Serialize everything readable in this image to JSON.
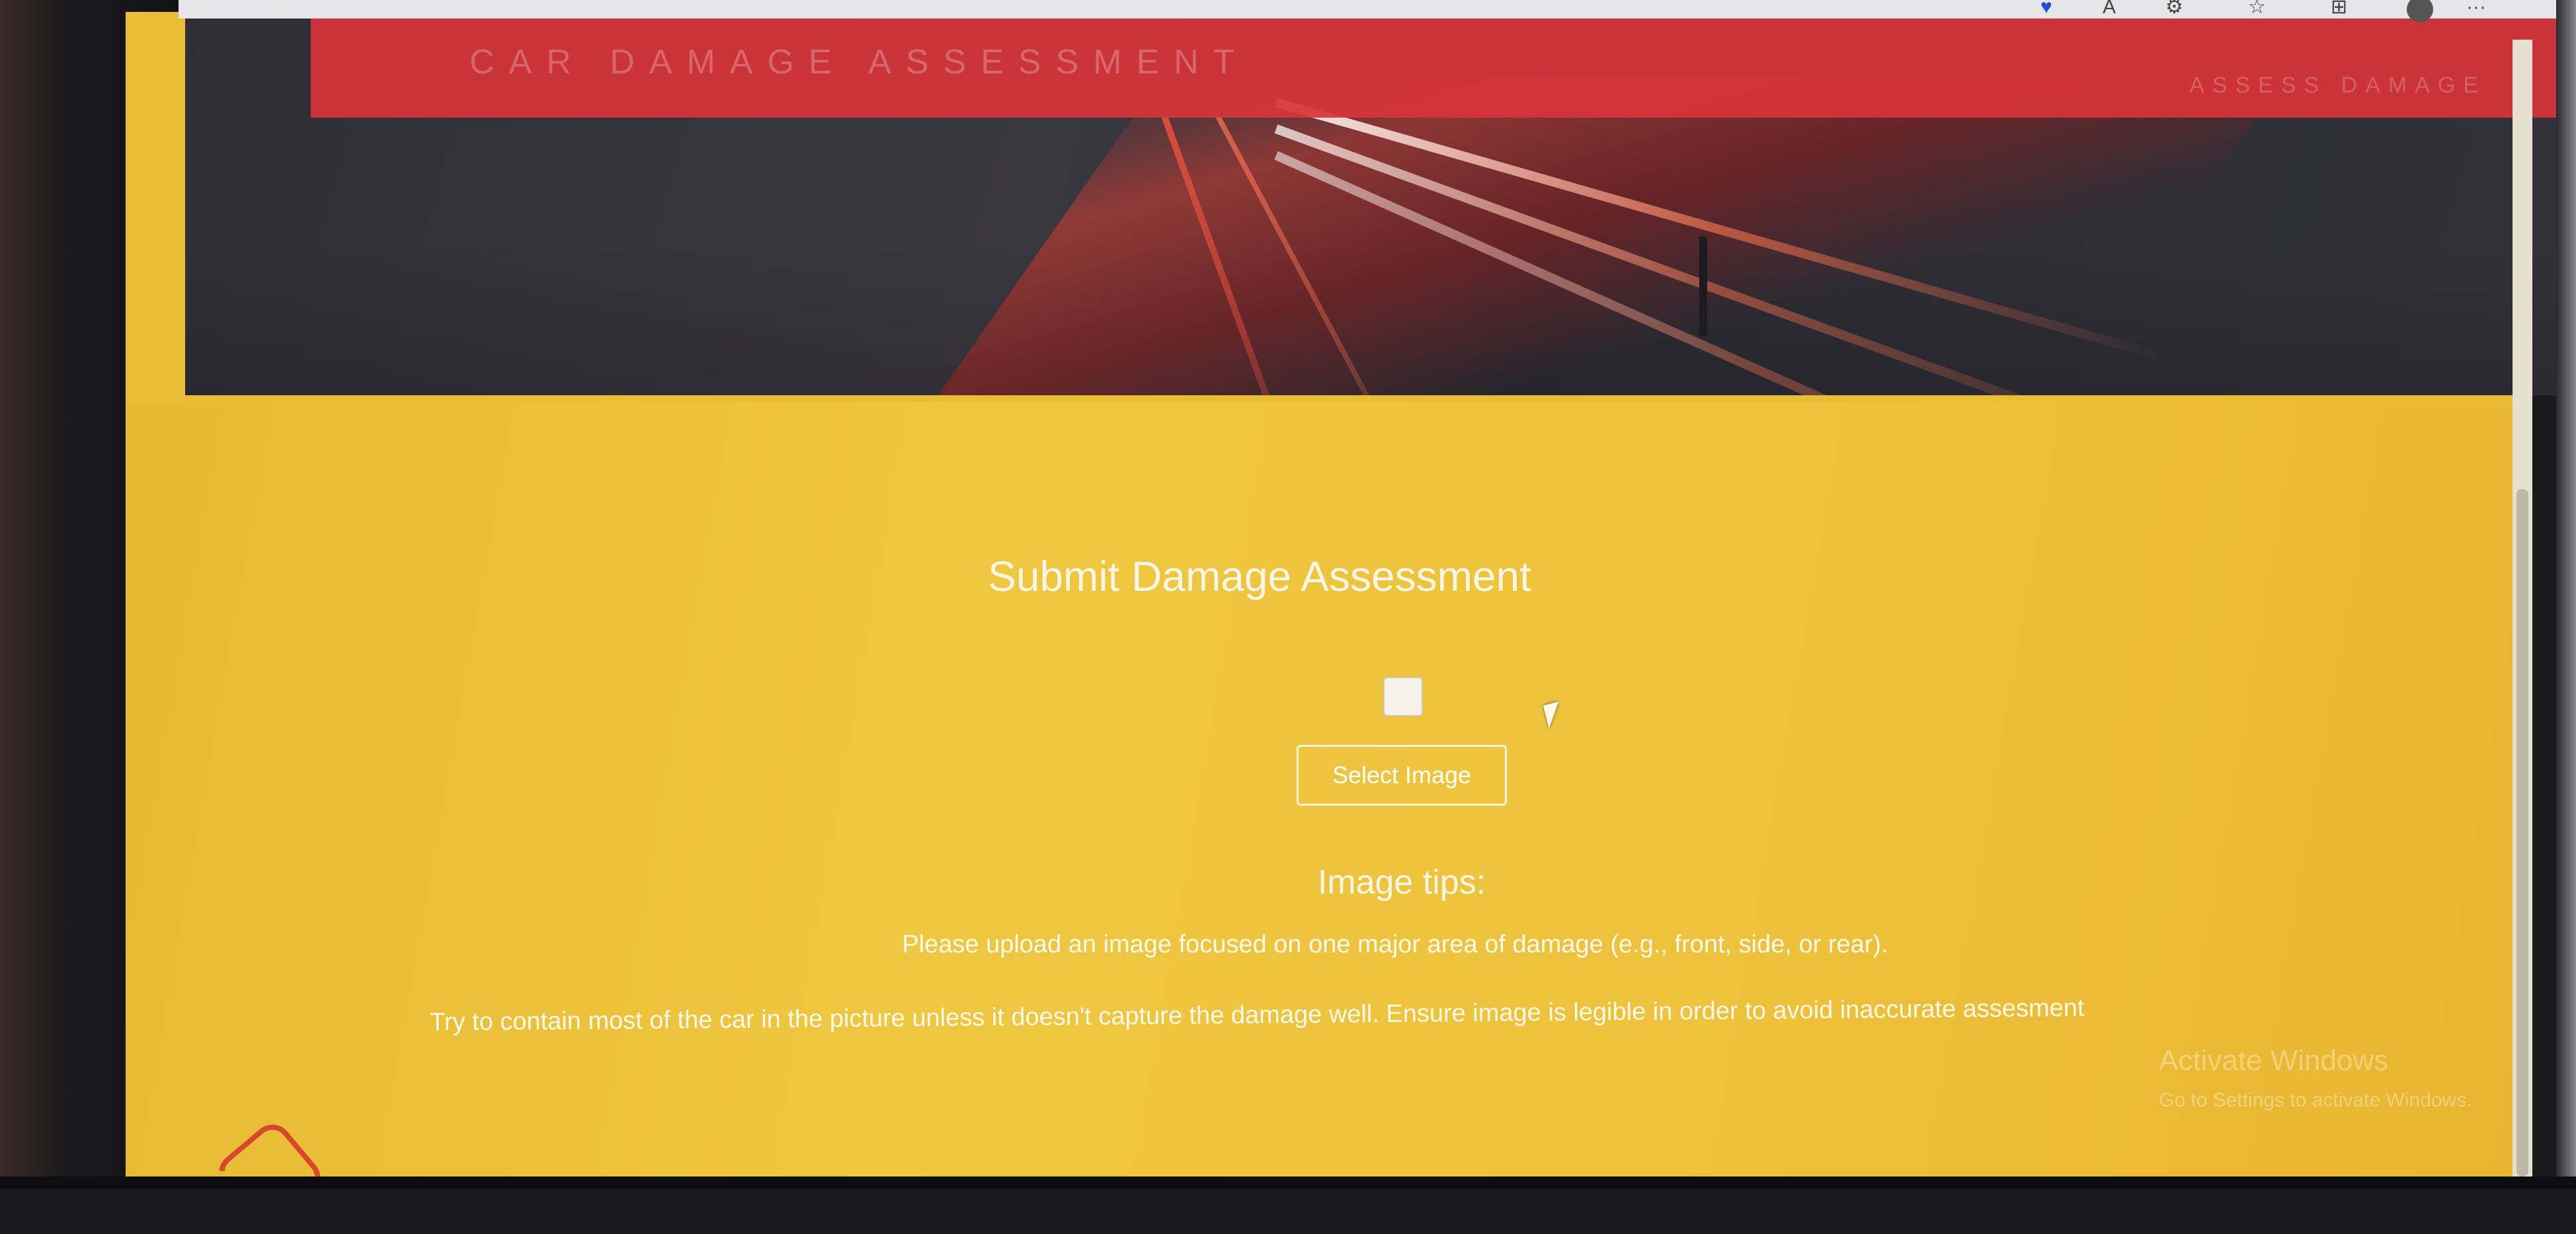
{
  "browser": {
    "toolbar_icons": [
      "read-aloud-icon",
      "favorites-icon",
      "collections-icon",
      "extensions-icon",
      "profile-icon",
      "more-icon"
    ],
    "more_label": "···"
  },
  "navbar": {
    "brand": "CAR DAMAGE ASSESSMENT",
    "link": "ASSESS DAMAGE"
  },
  "main": {
    "title": "Submit Damage Assessment",
    "checkbox_checked": false,
    "select_button": "Select Image",
    "tips_heading": "Image tips:",
    "tips": [
      "Please upload an image focused on one major area of damage (e.g., front, side, or rear).",
      "Try to contain most of the car in the picture unless it doesn't capture the damage well. Ensure image is legible in order to avoid inaccurate assesment"
    ]
  },
  "watermark": {
    "title": "Activate Windows",
    "subtitle": "Go to Settings to activate Windows."
  },
  "colors": {
    "navbar": "#d6343a",
    "content_bg": "#ecc03a",
    "text_light": "#fdf6e6"
  }
}
